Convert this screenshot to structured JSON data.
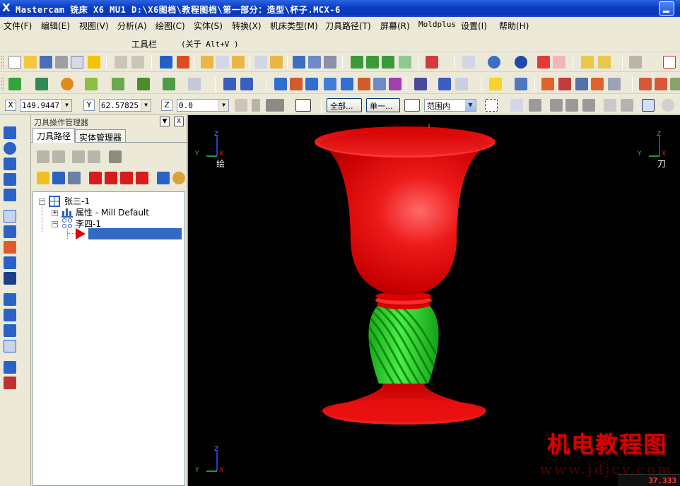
{
  "window": {
    "app_icon": "X",
    "title": "Mastercam 铣床 X6 MU1  D:\\X6图档\\教程图档\\第一部分：造型\\杯子.MCX-6"
  },
  "menu": [
    "文件(F)",
    "编辑(E)",
    "视图(V)",
    "分析(A)",
    "绘图(C)",
    "实体(S)",
    "转换(X)",
    "机床类型(M)",
    "刀具路径(T)",
    "屏幕(R)",
    "Moldplus",
    "设置(I)",
    "帮助(H)"
  ],
  "toolbar_caption": {
    "label": "工具栏",
    "about": "(关于 Alt+V )"
  },
  "coords": {
    "x_label": "X",
    "x_value": "149.9447",
    "y_label": "Y",
    "y_value": "62.57825",
    "z_label": "Z",
    "z_value": "0.0",
    "all_button": "全部...",
    "single_button": "单一...",
    "range_select": "范围内"
  },
  "panel": {
    "title": "刀具操作管理器",
    "tabs": [
      "刀具路径",
      "实体管理器"
    ],
    "tree": {
      "machine_group": "张三-1",
      "properties": "属性 - Mill Default",
      "toolpath_group": "李四-1"
    }
  },
  "viewport": {
    "top_left_view_label": "绘",
    "top_right_view_label": "刀",
    "axis_labels": {
      "x": "X",
      "y": "Y",
      "z": "Z"
    },
    "watermark": "机电教程图",
    "watermark_url": "www.jdjcy.com",
    "zoom_readout": "37.333"
  },
  "colors": {
    "cup_red": "#e00000",
    "stem_green": "#22d822",
    "viewport_bg": "#000000",
    "selection_blue": "#316ac5"
  },
  "icons": {
    "left_strip": [
      "point-icon",
      "arc-icon",
      "spline-icon",
      "arrow-down-icon",
      "solid-box-icon",
      "wireframe-icon",
      "shaded-solid-icon",
      "sphere-icon",
      "cylinder-icon",
      "solid-block-icon",
      "extrude-icon",
      "revolve-icon",
      "loft-icon",
      "boolean-icon",
      "view-icon",
      "layer-icon"
    ]
  }
}
